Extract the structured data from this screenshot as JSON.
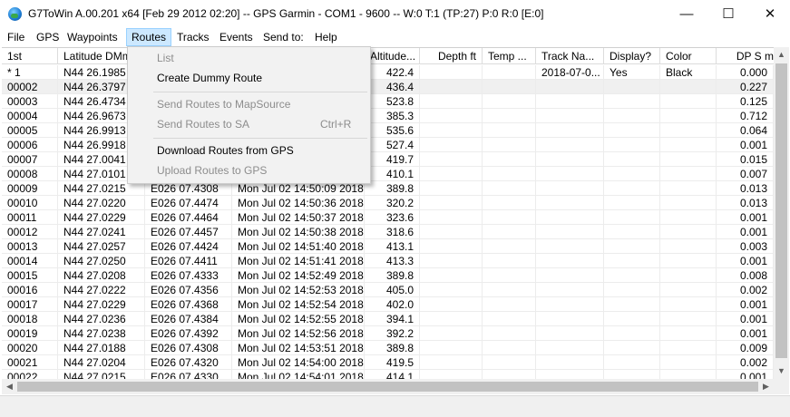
{
  "window": {
    "title": "G7ToWin A.00.201 x64 [Feb 29 2012 02:20] -- GPS Garmin - COM1 - 9600 -- W:0 T:1 (TP:27) P:0 R:0 [E:0]",
    "min_glyph": "—",
    "max_glyph": "☐",
    "close_glyph": "✕"
  },
  "menu": [
    "File",
    "GPS",
    "Waypoints",
    "Routes",
    "Tracks",
    "Events",
    "Send to:",
    "Help"
  ],
  "routes_menu": {
    "items": [
      {
        "label": "List",
        "shortcut": "",
        "disabled": true
      },
      {
        "label": "Create Dummy Route",
        "shortcut": "",
        "disabled": false
      },
      {
        "label": "Send Routes to MapSource",
        "shortcut": "",
        "disabled": true
      },
      {
        "label": "Send Routes to SA",
        "shortcut": "Ctrl+R",
        "disabled": true
      },
      {
        "label": "Download Routes from GPS",
        "shortcut": "",
        "disabled": false
      },
      {
        "label": "Upload Routes to GPS",
        "shortcut": "",
        "disabled": true
      }
    ]
  },
  "columns": [
    "1st",
    "Latitude DMm",
    "",
    "",
    "Altitude...",
    "Depth  ft",
    "Temp  ...",
    "Track Na...",
    "Display?",
    "Color",
    "DP  S m"
  ],
  "rows": [
    [
      "*    1",
      "N44 26.1985",
      "",
      "",
      "422.4",
      "",
      "",
      "2018-07-0...",
      "Yes",
      "Black",
      "0.000"
    ],
    [
      "00002",
      "N44 26.3797",
      "",
      "",
      "436.4",
      "",
      "",
      "",
      "",
      "",
      "0.227"
    ],
    [
      "00003",
      "N44 26.4734",
      "",
      "",
      "523.8",
      "",
      "",
      "",
      "",
      "",
      "0.125"
    ],
    [
      "00004",
      "N44 26.9673",
      "",
      "",
      "385.3",
      "",
      "",
      "",
      "",
      "",
      "0.712"
    ],
    [
      "00005",
      "N44 26.9913",
      "",
      "",
      "535.6",
      "",
      "",
      "",
      "",
      "",
      "0.064"
    ],
    [
      "00006",
      "N44 26.9918",
      "",
      "",
      "527.4",
      "",
      "",
      "",
      "",
      "",
      "0.001"
    ],
    [
      "00007",
      "N44 27.0041",
      "",
      "",
      "419.7",
      "",
      "",
      "",
      "",
      "",
      "0.015"
    ],
    [
      "00008",
      "N44 27.0101",
      "",
      "",
      "410.1",
      "",
      "",
      "",
      "",
      "",
      "0.007"
    ],
    [
      "00009",
      "N44 27.0215",
      "E026 07.4308",
      "Mon Jul 02 14:50:09 2018",
      "389.8",
      "",
      "",
      "",
      "",
      "",
      "0.013"
    ],
    [
      "00010",
      "N44 27.0220",
      "E026 07.4474",
      "Mon Jul 02 14:50:36 2018",
      "320.2",
      "",
      "",
      "",
      "",
      "",
      "0.013"
    ],
    [
      "00011",
      "N44 27.0229",
      "E026 07.4464",
      "Mon Jul 02 14:50:37 2018",
      "323.6",
      "",
      "",
      "",
      "",
      "",
      "0.001"
    ],
    [
      "00012",
      "N44 27.0241",
      "E026 07.4457",
      "Mon Jul 02 14:50:38 2018",
      "318.6",
      "",
      "",
      "",
      "",
      "",
      "0.001"
    ],
    [
      "00013",
      "N44 27.0257",
      "E026 07.4424",
      "Mon Jul 02 14:51:40 2018",
      "413.1",
      "",
      "",
      "",
      "",
      "",
      "0.003"
    ],
    [
      "00014",
      "N44 27.0250",
      "E026 07.4411",
      "Mon Jul 02 14:51:41 2018",
      "413.3",
      "",
      "",
      "",
      "",
      "",
      "0.001"
    ],
    [
      "00015",
      "N44 27.0208",
      "E026 07.4333",
      "Mon Jul 02 14:52:49 2018",
      "389.8",
      "",
      "",
      "",
      "",
      "",
      "0.008"
    ],
    [
      "00016",
      "N44 27.0222",
      "E026 07.4356",
      "Mon Jul 02 14:52:53 2018",
      "405.0",
      "",
      "",
      "",
      "",
      "",
      "0.002"
    ],
    [
      "00017",
      "N44 27.0229",
      "E026 07.4368",
      "Mon Jul 02 14:52:54 2018",
      "402.0",
      "",
      "",
      "",
      "",
      "",
      "0.001"
    ],
    [
      "00018",
      "N44 27.0236",
      "E026 07.4384",
      "Mon Jul 02 14:52:55 2018",
      "394.1",
      "",
      "",
      "",
      "",
      "",
      "0.001"
    ],
    [
      "00019",
      "N44 27.0238",
      "E026 07.4392",
      "Mon Jul 02 14:52:56 2018",
      "392.2",
      "",
      "",
      "",
      "",
      "",
      "0.001"
    ],
    [
      "00020",
      "N44 27.0188",
      "E026 07.4308",
      "Mon Jul 02 14:53:51 2018",
      "389.8",
      "",
      "",
      "",
      "",
      "",
      "0.009"
    ],
    [
      "00021",
      "N44 27.0204",
      "E026 07.4320",
      "Mon Jul 02 14:54:00 2018",
      "419.5",
      "",
      "",
      "",
      "",
      "",
      "0.002"
    ],
    [
      "00022",
      "N44 27.0215",
      "E026 07.4330",
      "Mon Jul 02 14:54:01 2018",
      "414.1",
      "",
      "",
      "",
      "",
      "",
      "0.001"
    ]
  ],
  "scroll": {
    "up": "▲",
    "down": "▼",
    "left": "◀",
    "right": "▶"
  },
  "colors": {
    "menu_highlight": "#cce8ff",
    "menu_highlight_border": "#99d1ff",
    "dropdown_bg": "#f2f2f2",
    "disabled_text": "#8d8d8d"
  },
  "icons": {
    "app": "globe-icon"
  }
}
